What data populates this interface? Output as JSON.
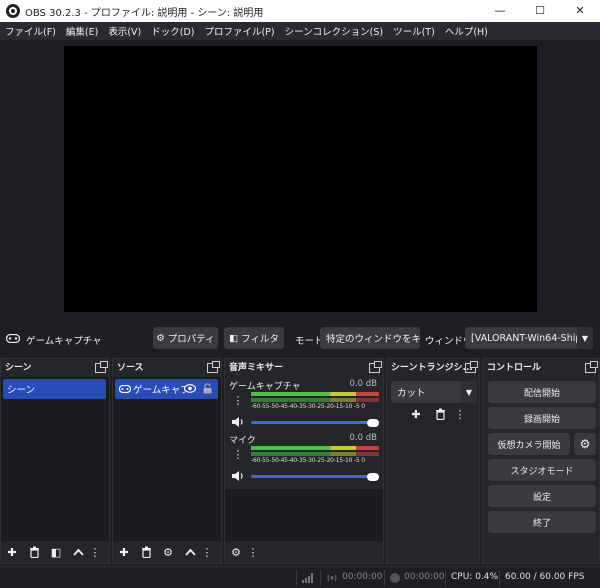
{
  "window": {
    "title": "OBS 30.2.3 - プロファイル: 説明用 - シーン: 説明用",
    "minimize": "—",
    "maximize": "☐",
    "close": "✕"
  },
  "menu": [
    "ファイル(F)",
    "編集(E)",
    "表示(V)",
    "ドック(D)",
    "プロファイル(P)",
    "シーンコレクション(S)",
    "ツール(T)",
    "ヘルプ(H)"
  ],
  "source_toolbar": {
    "source_name": "ゲームキャプチャ",
    "properties_label": "プロパティ",
    "filters_label": "フィルタ",
    "mode_label": "モード",
    "mode_value": "特定のウィンドウをキ",
    "window_label": "ウィンドウ",
    "window_value": "[VALORANT-Win64-Ship"
  },
  "scenes": {
    "title": "シーン",
    "items": [
      "シーン"
    ]
  },
  "sources": {
    "title": "ソース",
    "items": [
      "ゲームキャプチャ"
    ]
  },
  "mixer": {
    "title": "音声ミキサー",
    "channels": [
      {
        "name": "ゲームキャプチャ",
        "db": "0.0 dB"
      },
      {
        "name": "マイク",
        "db": "0.0 dB"
      }
    ],
    "ticks": "-60-55-50-45-40-35-30-25-20-15-10 -5  0"
  },
  "transitions": {
    "title": "シーントランジシ...",
    "value": "カット"
  },
  "controls": {
    "title": "コントロール",
    "start_streaming": "配信開始",
    "start_recording": "録画開始",
    "start_virtualcam": "仮想カメラ開始",
    "studio_mode": "スタジオモード",
    "settings": "設定",
    "exit": "終了"
  },
  "status": {
    "stream_time": "00:00:00",
    "rec_time": "00:00:00",
    "cpu": "CPU: 0.4%",
    "fps": "60.00 / 60.00 FPS"
  },
  "icons": {
    "gamepad": "gamepad-icon",
    "gear": "gear-icon",
    "filter": "filter-icon",
    "eye": "eye-icon",
    "lock": "lock-icon",
    "speaker": "speaker-icon",
    "add": "plus-icon",
    "remove": "trash-icon",
    "up": "chevron-up-icon",
    "more": "more-vertical-icon",
    "popout": "popout-icon"
  },
  "colors": {
    "accent": "#284cb8",
    "background": "#1e1f24",
    "panel": "#25262b",
    "button": "#3a3b41"
  }
}
